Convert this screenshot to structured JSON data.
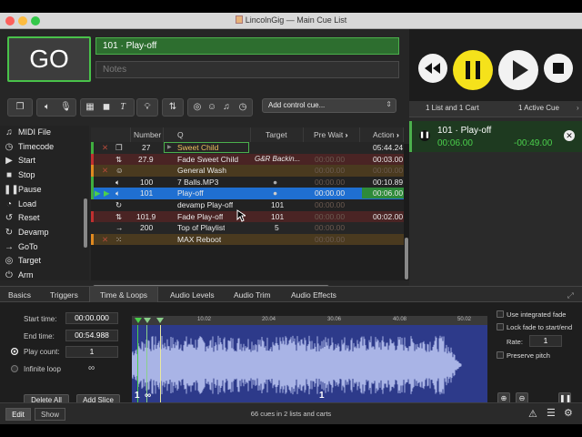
{
  "window": {
    "title": "LincolnGig — Main Cue List"
  },
  "go": {
    "label": "GO"
  },
  "cue_name_field": {
    "value": "101 · Play-off"
  },
  "notes_field": {
    "placeholder": "Notes"
  },
  "toolbar": {
    "control_cue_select": "Add control cue..."
  },
  "sidebar": {
    "items": [
      {
        "label": "MIDI File",
        "icon": "music-note-icon"
      },
      {
        "label": "Timecode",
        "icon": "clock-icon"
      },
      {
        "label": "Start",
        "icon": "play-icon"
      },
      {
        "label": "Stop",
        "icon": "stop-icon"
      },
      {
        "label": "Pause",
        "icon": "pause-icon"
      },
      {
        "label": "Load",
        "icon": "load-icon"
      },
      {
        "label": "Reset",
        "icon": "reset-icon"
      },
      {
        "label": "Devamp",
        "icon": "devamp-icon"
      },
      {
        "label": "GoTo",
        "icon": "goto-icon"
      },
      {
        "label": "Target",
        "icon": "target-icon"
      },
      {
        "label": "Arm",
        "icon": "power-icon"
      }
    ]
  },
  "table": {
    "columns": {
      "number": "Number",
      "q": "Q",
      "target": "Target",
      "pre_wait": "Pre Wait",
      "action": "Action"
    },
    "rows": [
      {
        "number": "27",
        "name": "Sweet Child",
        "target": "",
        "pre_wait": "",
        "action": "05:44.24",
        "style": "dark"
      },
      {
        "number": "27.9",
        "name": "Fade Sweet Child",
        "target": "G&R Backin...",
        "pre_wait": "00:00.00",
        "action": "00:03.00",
        "style": "red"
      },
      {
        "number": "",
        "name": "General Wash",
        "target": "",
        "pre_wait": "00:00.00",
        "action": "00:00.00",
        "style": "orange"
      },
      {
        "number": "100",
        "name": "7 Balls.MP3",
        "target": "",
        "pre_wait": "00:00.00",
        "action": "00:10.89",
        "style": "darker"
      },
      {
        "number": "101",
        "name": "Play-off",
        "target": "",
        "pre_wait": "00:00.00",
        "action": "00:06.00",
        "style": "selected"
      },
      {
        "number": "",
        "name": "devamp Play-off",
        "target": "101",
        "pre_wait": "00:00.00",
        "action": "",
        "style": "darker"
      },
      {
        "number": "101.9",
        "name": "Fade Play-off",
        "target": "101",
        "pre_wait": "00:00.00",
        "action": "00:02.00",
        "style": "red"
      },
      {
        "number": "200",
        "name": "Top of Playlist",
        "target": "5",
        "pre_wait": "00:00.00",
        "action": "",
        "style": "dark"
      },
      {
        "number": "",
        "name": "MAX Reboot",
        "target": "",
        "pre_wait": "00:00.00",
        "action": "",
        "style": "orange"
      }
    ]
  },
  "lists_panel": {
    "tab_lists": "1 List and 1 Cart",
    "tab_active": "1 Active Cue",
    "active_cue": {
      "title": "101 · Play-off",
      "elapsed": "00:06.00",
      "remaining": "-00:49.00"
    }
  },
  "inspector": {
    "tabs": [
      "Basics",
      "Triggers",
      "Time & Loops",
      "Audio Levels",
      "Audio Trim",
      "Audio Effects"
    ],
    "start_time_label": "Start time:",
    "start_time": "00:00.000",
    "end_time_label": "End time:",
    "end_time": "00:54.988",
    "play_count_label": "Play count:",
    "play_count": "1",
    "infinite_loop_label": "Infinite loop",
    "infinite_symbol": "∞",
    "delete_all": "Delete All",
    "add_slice": "Add Slice",
    "ruler": [
      "10.02",
      "20.04",
      "30.06",
      "40.08",
      "50.02"
    ],
    "slice_left": "1",
    "slice_mid": "1",
    "slice_loop": "∞",
    "use_integrated_fade": "Use integrated fade",
    "lock_fade": "Lock fade to start/end",
    "rate_label": "Rate:",
    "rate": "1",
    "preserve_pitch": "Preserve pitch"
  },
  "statusbar": {
    "text": "66 cues in 2 lists and carts",
    "edit": "Edit",
    "show": "Show"
  },
  "colors": {
    "go_border": "#49c24a",
    "selected_row": "#1f6fd1",
    "pause_yellow": "#f5e21b",
    "active_green": "#4bd04c"
  }
}
